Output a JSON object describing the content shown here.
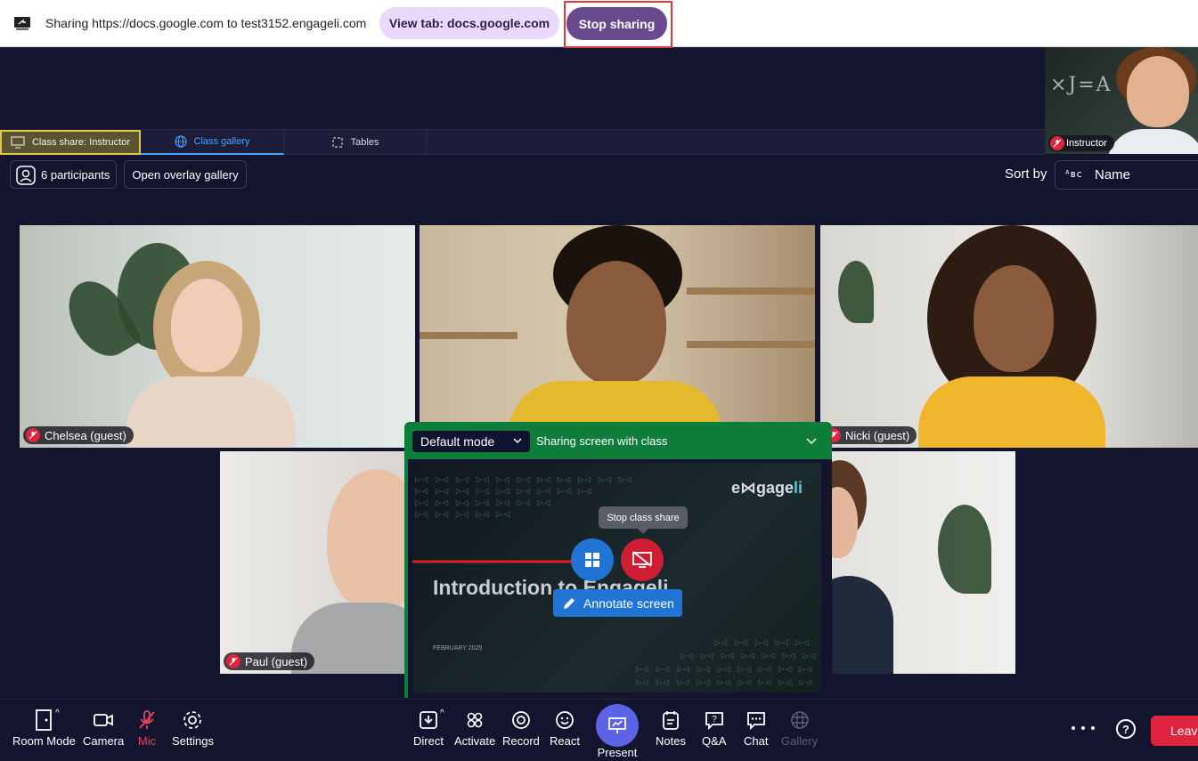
{
  "share_bar": {
    "message": "Sharing https://docs.google.com to test3152.engageli.com",
    "view_tab_label": "View tab: docs.google.com",
    "stop_sharing_label": "Stop sharing"
  },
  "instructor": {
    "name": "Instructor",
    "chalk": "×J=A"
  },
  "tabs": [
    {
      "label": "Class share: Instructor",
      "icon": "screen-share-icon",
      "active": false
    },
    {
      "label": "Class gallery",
      "icon": "globe-icon",
      "active": true
    },
    {
      "label": "Tables",
      "icon": "tables-icon",
      "active": false
    }
  ],
  "gallery_header": {
    "participants_label": "6 participants",
    "overlay_label": "Open overlay gallery",
    "sort_by_label": "Sort by",
    "sort_icon_text": "ᴬʙc",
    "sort_value": "Name"
  },
  "participants": [
    {
      "name": "Chelsea (guest)",
      "muted": true
    },
    {
      "name": "Nicki (guest)",
      "muted": true
    },
    {
      "name": "Paul (guest)",
      "muted": true
    }
  ],
  "share_panel": {
    "mode": "Default mode",
    "status": "Sharing screen with class",
    "logo_main": "e⋈gage",
    "logo_accent": "li",
    "slide_title": "Introduction to Engageli",
    "slide_date": "FEBRUARY 2025",
    "tooltip": "Stop class share",
    "annotate_label": "Annotate screen"
  },
  "toolbar": {
    "room_mode": "Room Mode",
    "camera": "Camera",
    "mic": "Mic",
    "settings": "Settings",
    "direct": "Direct",
    "activate": "Activate",
    "record": "Record",
    "react": "React",
    "present": "Present",
    "notes": "Notes",
    "qa": "Q&A",
    "chat": "Chat",
    "gallery": "Gallery",
    "help": "?",
    "leave": "Leave"
  },
  "colors": {
    "background": "#13142e",
    "accent_blue": "#4aa3ff",
    "share_green": "#0e7d3a",
    "stop_red": "#cf1d34",
    "stop_sharing_purple": "#6a4a8f",
    "highlight_red": "#e53935"
  }
}
